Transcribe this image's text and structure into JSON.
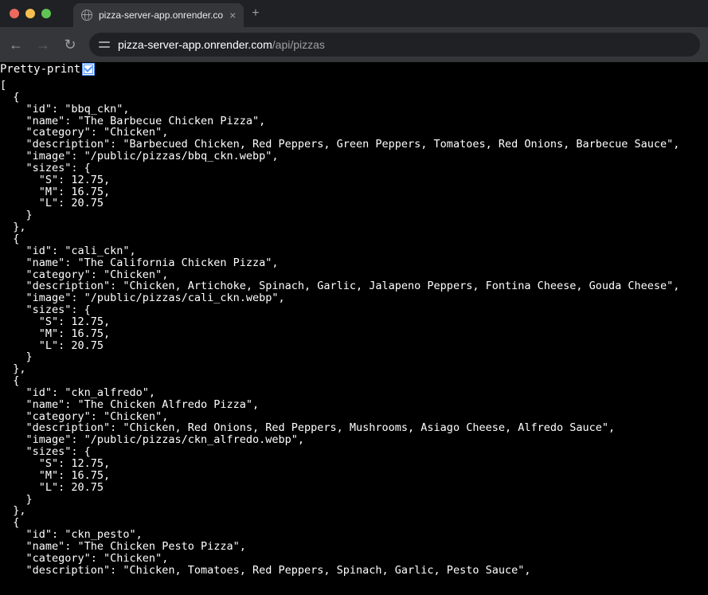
{
  "tab": {
    "title": "pizza-server-app.onrender.co"
  },
  "toolbar": {
    "url_host": "pizza-server-app.onrender.com",
    "url_path": "/api/pizzas"
  },
  "pretty_print": {
    "label": "Pretty-print",
    "checked": true
  },
  "json_body": "[\n  {\n    \"id\": \"bbq_ckn\",\n    \"name\": \"The Barbecue Chicken Pizza\",\n    \"category\": \"Chicken\",\n    \"description\": \"Barbecued Chicken, Red Peppers, Green Peppers, Tomatoes, Red Onions, Barbecue Sauce\",\n    \"image\": \"/public/pizzas/bbq_ckn.webp\",\n    \"sizes\": {\n      \"S\": 12.75,\n      \"M\": 16.75,\n      \"L\": 20.75\n    }\n  },\n  {\n    \"id\": \"cali_ckn\",\n    \"name\": \"The California Chicken Pizza\",\n    \"category\": \"Chicken\",\n    \"description\": \"Chicken, Artichoke, Spinach, Garlic, Jalapeno Peppers, Fontina Cheese, Gouda Cheese\",\n    \"image\": \"/public/pizzas/cali_ckn.webp\",\n    \"sizes\": {\n      \"S\": 12.75,\n      \"M\": 16.75,\n      \"L\": 20.75\n    }\n  },\n  {\n    \"id\": \"ckn_alfredo\",\n    \"name\": \"The Chicken Alfredo Pizza\",\n    \"category\": \"Chicken\",\n    \"description\": \"Chicken, Red Onions, Red Peppers, Mushrooms, Asiago Cheese, Alfredo Sauce\",\n    \"image\": \"/public/pizzas/ckn_alfredo.webp\",\n    \"sizes\": {\n      \"S\": 12.75,\n      \"M\": 16.75,\n      \"L\": 20.75\n    }\n  },\n  {\n    \"id\": \"ckn_pesto\",\n    \"name\": \"The Chicken Pesto Pizza\",\n    \"category\": \"Chicken\",\n    \"description\": \"Chicken, Tomatoes, Red Peppers, Spinach, Garlic, Pesto Sauce\","
}
